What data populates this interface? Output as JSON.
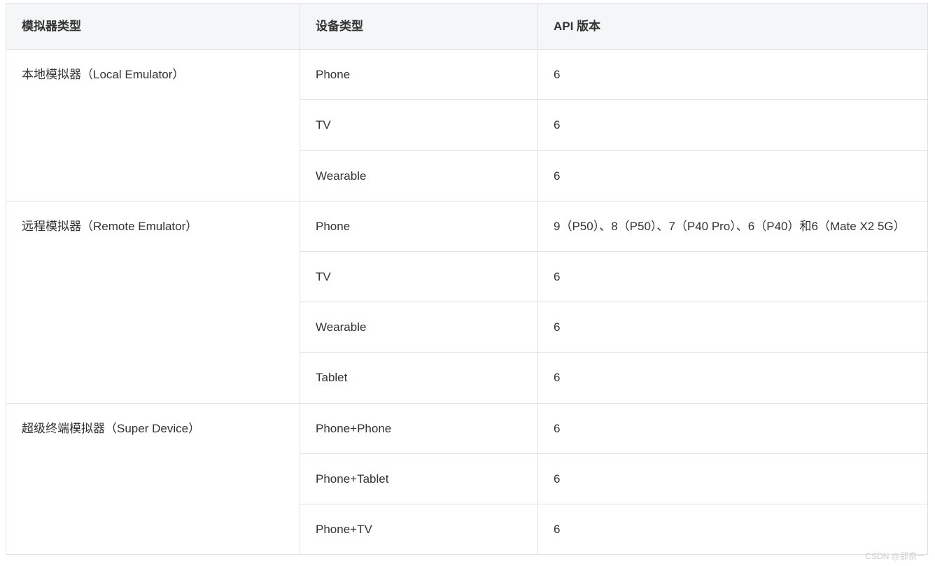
{
  "headers": {
    "emulator_type": "模拟器类型",
    "device_type": "设备类型",
    "api_version": "API 版本"
  },
  "groups": [
    {
      "emulator": "本地模拟器（Local Emulator）",
      "rows": [
        {
          "device": "Phone",
          "api": "6"
        },
        {
          "device": "TV",
          "api": "6"
        },
        {
          "device": "Wearable",
          "api": "6"
        }
      ]
    },
    {
      "emulator": "远程模拟器（Remote Emulator）",
      "rows": [
        {
          "device": "Phone",
          "api": "9（P50）、8（P50）、7（P40 Pro）、6（P40）和6（Mate X2 5G）"
        },
        {
          "device": "TV",
          "api": "6"
        },
        {
          "device": "Wearable",
          "api": "6"
        },
        {
          "device": "Tablet",
          "api": "6"
        }
      ]
    },
    {
      "emulator": "超级终端模拟器（Super Device）",
      "rows": [
        {
          "device": "Phone+Phone",
          "api": "6"
        },
        {
          "device": "Phone+Tablet",
          "api": "6"
        },
        {
          "device": "Phone+TV",
          "api": "6"
        }
      ]
    }
  ],
  "watermark": "CSDN @邵奈一"
}
